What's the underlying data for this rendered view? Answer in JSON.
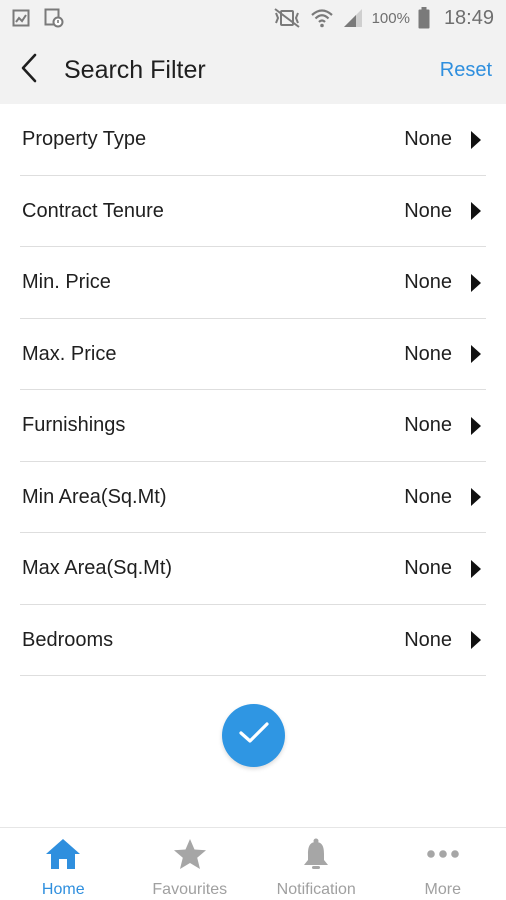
{
  "status_bar": {
    "battery": "100%",
    "time": "18:49"
  },
  "header": {
    "title": "Search Filter",
    "reset_label": "Reset"
  },
  "filters": [
    {
      "label": "Property Type",
      "value": "None"
    },
    {
      "label": "Contract Tenure",
      "value": "None"
    },
    {
      "label": "Min. Price",
      "value": "None"
    },
    {
      "label": "Max. Price",
      "value": "None"
    },
    {
      "label": "Furnishings",
      "value": "None"
    },
    {
      "label": "Min Area(Sq.Mt)",
      "value": "None"
    },
    {
      "label": "Max Area(Sq.Mt)",
      "value": "None"
    },
    {
      "label": "Bedrooms",
      "value": "None"
    }
  ],
  "bottom_nav": [
    {
      "label": "Home",
      "icon": "home-icon",
      "active": true
    },
    {
      "label": "Favourites",
      "icon": "star-icon",
      "active": false
    },
    {
      "label": "Notification",
      "icon": "bell-icon",
      "active": false
    },
    {
      "label": "More",
      "icon": "more-dots-icon",
      "active": false
    }
  ],
  "colors": {
    "accent": "#2f8fde",
    "confirm_button": "#2f96e3",
    "inactive": "#a0a0a0",
    "header_bg": "#f2f2f2"
  }
}
